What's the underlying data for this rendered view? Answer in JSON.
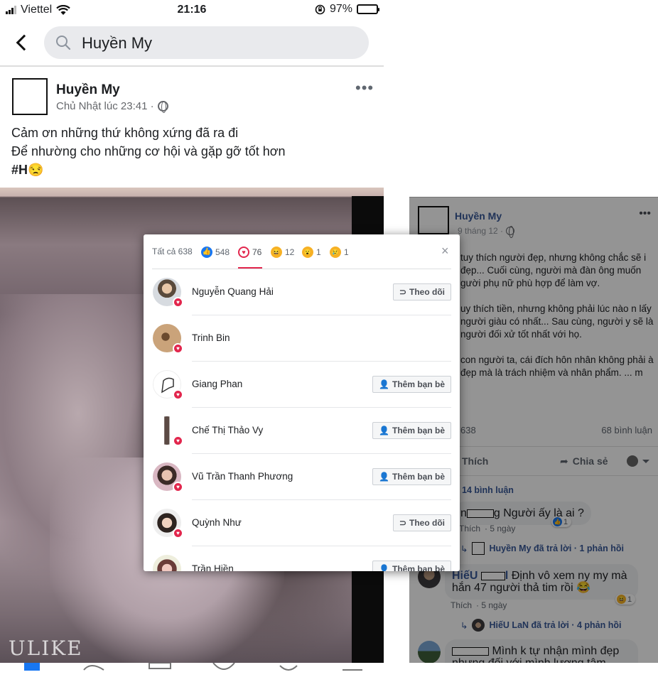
{
  "status_bar": {
    "carrier": "Viettel",
    "time": "21:16",
    "battery": "97%",
    "battery_level": 0.97
  },
  "search": {
    "query": "Huyền My"
  },
  "post": {
    "author": "Huyền My",
    "time": "Chủ Nhật lúc 23:41 ·",
    "line1": "Cảm ơn những thứ không xứng đã ra đi",
    "line2": "Để nhường cho những cơ hội và gặp gỡ tốt hơn",
    "hashtag": "#H",
    "emoji": "😒",
    "watermark": "ULIKE"
  },
  "reactions_modal": {
    "tabs": [
      {
        "label": "Tất cả 638",
        "icon": "all"
      },
      {
        "count": "548",
        "icon": "like-reaction-icon"
      },
      {
        "count": "76",
        "icon": "love-reaction-icon"
      },
      {
        "count": "12",
        "icon": "haha-reaction-icon"
      },
      {
        "count": "1",
        "icon": "wow-reaction-icon"
      },
      {
        "count": "1",
        "icon": "sad-reaction-icon"
      }
    ],
    "close": "×",
    "people": [
      {
        "name": "Nguyễn Quang Hải",
        "action": "Theo dõi",
        "action_icon": "rss-icon"
      },
      {
        "name": "Trinh Bin",
        "action": "",
        "action_icon": ""
      },
      {
        "name": "Giang Phan",
        "action": "Thêm bạn bè",
        "action_icon": "add-friend-icon"
      },
      {
        "name": "Chế Thị Thảo Vy",
        "action": "Thêm bạn bè",
        "action_icon": "add-friend-icon"
      },
      {
        "name": "Vũ Trần Thanh Phương",
        "action": "Thêm bạn bè",
        "action_icon": "add-friend-icon"
      },
      {
        "name": "Quỳnh Như",
        "action": "Theo dõi",
        "action_icon": "rss-icon"
      },
      {
        "name": "Trần Hiền",
        "action": "Thêm bạn bè",
        "action_icon": "add-friend-icon"
      }
    ]
  },
  "right_post": {
    "author": "Huyền My",
    "date": "9 tháng 12 ·",
    "para1": "tuy thích người đẹp, nhưng không chắc sẽ i đẹp... Cuối cùng, người mà đàn ông muốn gười phụ nữ phù hợp để làm vợ.",
    "para2": "uy thích tiền, nhưng không phải lúc nào n lấy người giàu có nhất... Sau cùng, người y sẽ là người đối xử tốt nhất với họ.",
    "para3": "con người ta, cái đích hôn nhân không phải à đẹp mà là trách nhiệm và nhân phẩm. ... m",
    "reaction_count": "638",
    "comment_count": "68 bình luận",
    "like_label": "Thích",
    "share_label": "Chia sẻ",
    "comments_link": "14 bình luận",
    "c1_text": "g Người ấy là ai ?",
    "c1_prefix": "n",
    "c1_like": "Thích",
    "c1_time": "· 5 ngày",
    "c1_badge": "1",
    "c1_reply": "Huyền My đã trả lời · 1 phản hồi",
    "c2_name_start": "HiếU",
    "c2_name_end": "l",
    "c2_text": "Định vô xem ny my mà hắn 47 người thả tim rồi 😂",
    "c2_like": "Thích",
    "c2_time": "· 5 ngày",
    "c2_badge": "1",
    "c2_reply": "HiếU LaN đã trả lời · 4 phản hồi",
    "c3_text": "Mình k tự nhận mình đẹp nhưng đối với mình lương tâm không tôi lỗi là thoải"
  },
  "colors": {
    "love": "#e2264d",
    "like": "#1877f2",
    "link": "#385898"
  }
}
